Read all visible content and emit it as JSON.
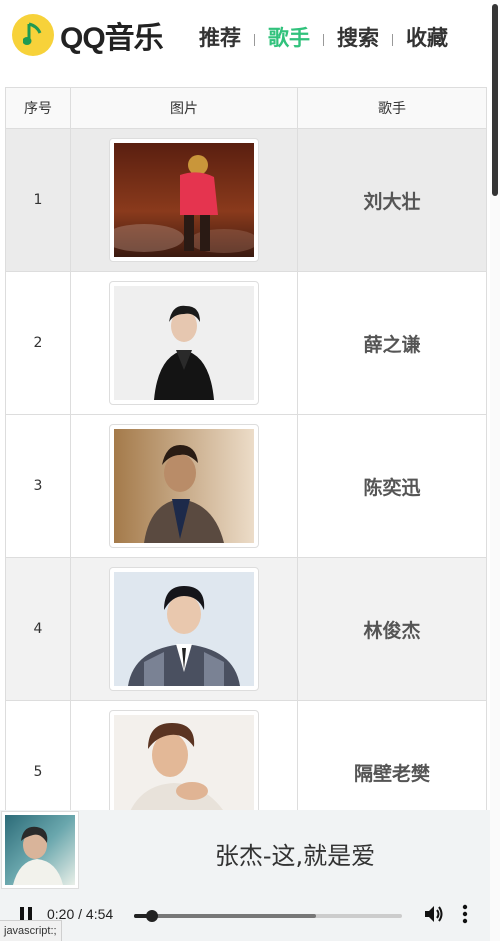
{
  "header": {
    "logo_text": "QQ音乐",
    "nav": [
      {
        "label": "推荐",
        "active": false
      },
      {
        "label": "歌手",
        "active": true
      },
      {
        "label": "搜索",
        "active": false
      },
      {
        "label": "收藏",
        "active": false
      }
    ]
  },
  "table": {
    "columns": [
      "序号",
      "图片",
      "歌手"
    ],
    "rows": [
      {
        "index": "1",
        "singer": "刘大壮"
      },
      {
        "index": "2",
        "singer": "薛之谦"
      },
      {
        "index": "3",
        "singer": "陈奕迅"
      },
      {
        "index": "4",
        "singer": "林俊杰"
      },
      {
        "index": "5",
        "singer": "隔壁老樊"
      }
    ]
  },
  "player": {
    "song_title": "张杰-这,就是爱",
    "time_display": "0:20 / 4:54",
    "progress_fraction": 0.068,
    "buffered_fraction": 0.68
  },
  "status_bar": {
    "url": "javascript:;"
  },
  "colors": {
    "accent": "#31c27c",
    "logo_yellow": "#f7d23a"
  }
}
